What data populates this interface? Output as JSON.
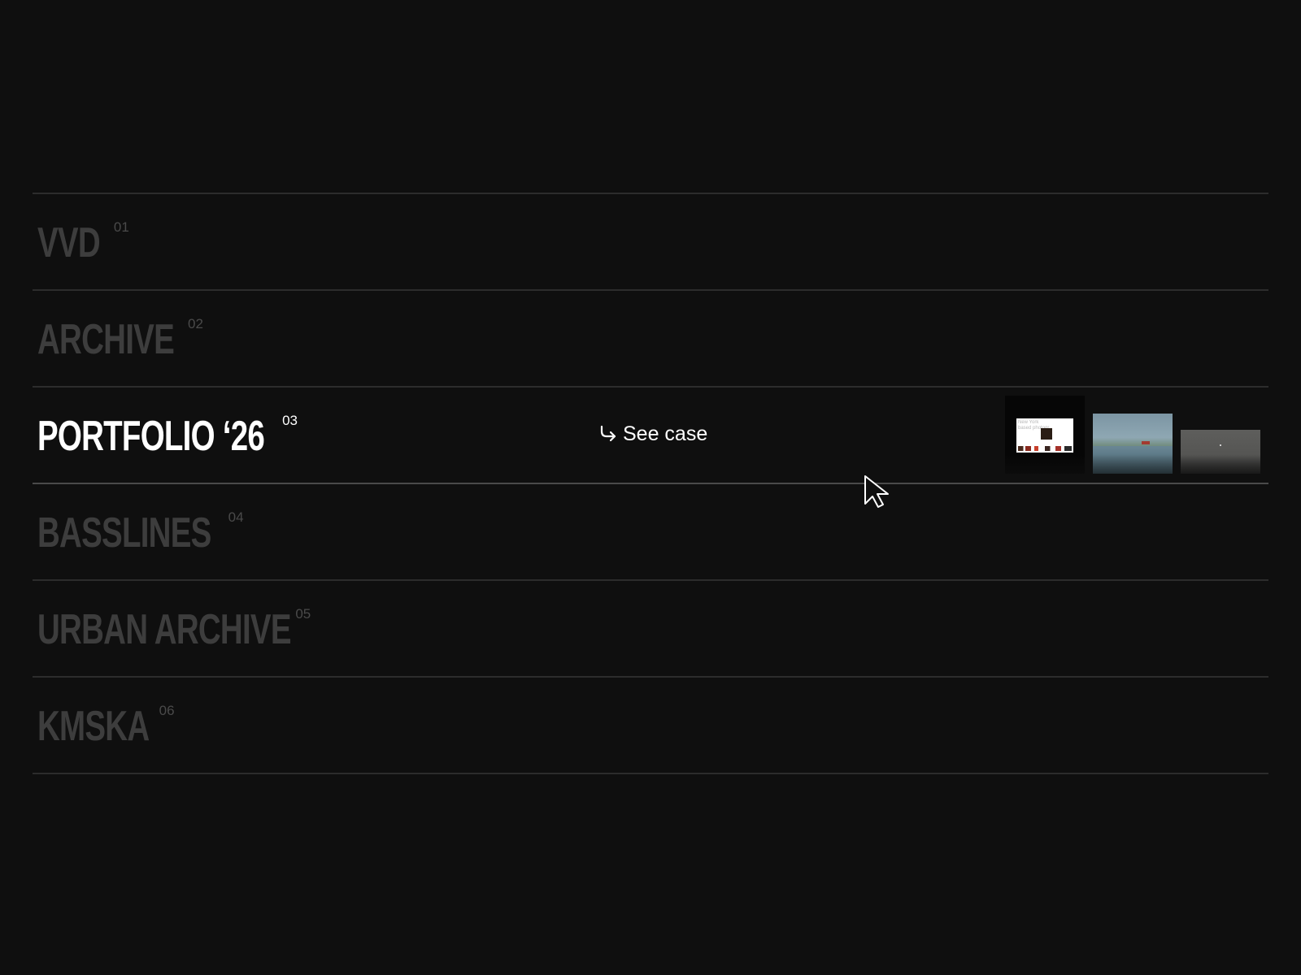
{
  "projects": [
    {
      "name": "VVD",
      "number": "01",
      "active": false
    },
    {
      "name": "ARCHIVE",
      "number": "02",
      "active": false
    },
    {
      "name": "PORTFOLIO ‘26",
      "number": "03",
      "active": true
    },
    {
      "name": "BASSLINES",
      "number": "04",
      "active": false
    },
    {
      "name": "URBAN ARCHIVE",
      "number": "05",
      "active": false
    },
    {
      "name": "KMSKA",
      "number": "06",
      "active": false
    }
  ],
  "active_row": {
    "see_case_label": "See case",
    "see_case_icon": "arrow-return-right-icon",
    "thumbnail_1_text": "New York based photogr"
  },
  "colors": {
    "background": "#0f0f0f",
    "inactive_text": "#3d3d3d",
    "active_text": "#ffffff",
    "divider": "#2c2c2c"
  }
}
